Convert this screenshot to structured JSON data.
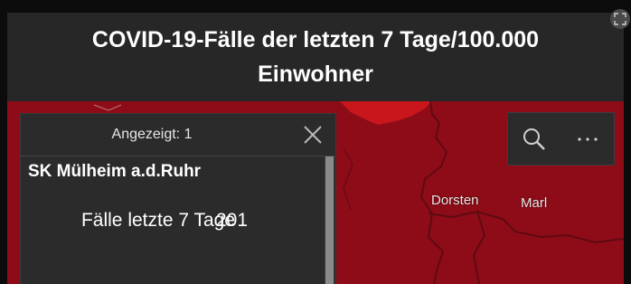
{
  "header": {
    "title": "COVID-19-Fälle der letzten 7 Tage/100.000 Einwohner"
  },
  "map": {
    "places": [
      "Dorsten",
      "Marl"
    ],
    "fill_color": "#8e0c18",
    "highlight_color": "#c8161c",
    "border_color": "#5e0a12"
  },
  "popup": {
    "count_label": "Angezeigt: 1",
    "feature_title": "SK Mülheim a.d.Ruhr",
    "field": {
      "label": "Fälle letzte 7 Tage",
      "value": "201"
    }
  },
  "icons": {
    "close": "close-icon",
    "search": "search-icon",
    "more": "more-icon",
    "expand": "expand-icon"
  }
}
